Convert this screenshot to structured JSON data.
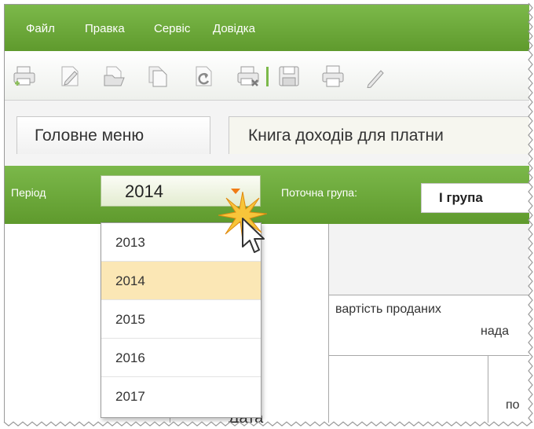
{
  "menubar": {
    "items": [
      "Файл",
      "Правка",
      "Сервіс",
      "Довідка"
    ]
  },
  "toolbar": {
    "icons": [
      "print-preview-add-icon",
      "edit-document-icon",
      "open-document-icon",
      "copy-document-icon",
      "refresh-document-icon",
      "print-delete-icon",
      "save-icon",
      "print-icon",
      "edit-icon"
    ]
  },
  "tabs": [
    {
      "label": "Головне меню",
      "active": false
    },
    {
      "label": "Книга доходів для платни",
      "active": true
    }
  ],
  "filter": {
    "period_label": "Період",
    "period_value": "2014",
    "group_label": "Поточна група:",
    "group_value": "І група"
  },
  "dropdown": {
    "options": [
      "2013",
      "2014",
      "2015",
      "2016",
      "2017"
    ],
    "selected": "2014"
  },
  "table": {
    "header_text_1": "вартість проданих",
    "header_text_2": "нада",
    "partial_cell": "по",
    "date_header": "Дата"
  },
  "colors": {
    "menu_green": "#6ca83a",
    "accent_orange": "#f07c16",
    "selected_item": "#fbe7b5"
  }
}
